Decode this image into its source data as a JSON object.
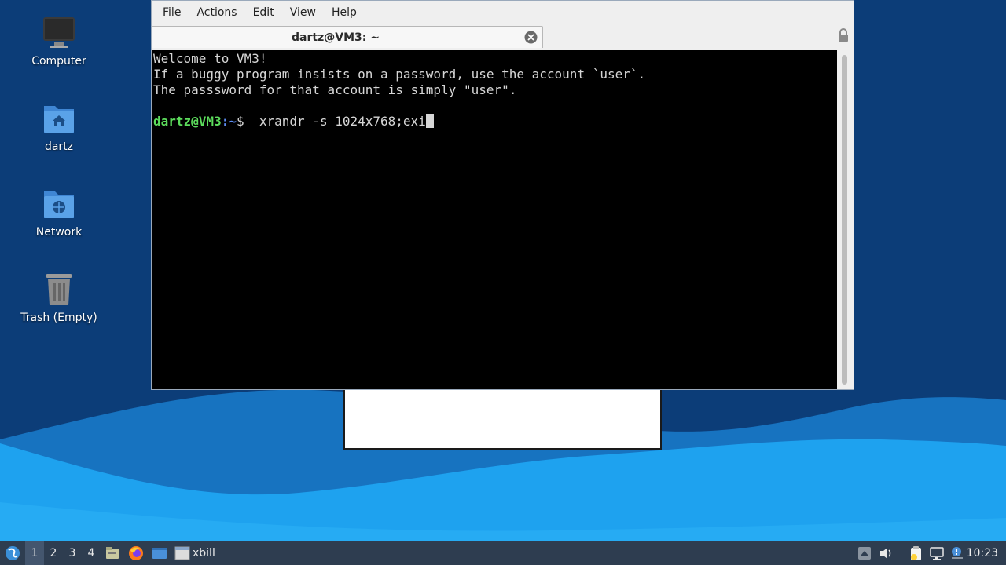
{
  "desktop": {
    "icons": [
      {
        "label": "Computer",
        "icon": "computer-icon"
      },
      {
        "label": "dartz",
        "icon": "home-folder-icon"
      },
      {
        "label": "Network",
        "icon": "network-folder-icon"
      },
      {
        "label": "Trash (Empty)",
        "icon": "trash-icon"
      }
    ]
  },
  "terminal": {
    "menu": [
      "File",
      "Actions",
      "Edit",
      "View",
      "Help"
    ],
    "tab_title": "dartz@VM3: ~",
    "lines": [
      "Welcome to VM3!",
      "If a buggy program insists on a password, use the account `user`.",
      "The passsword for that account is simply \"user\"."
    ],
    "prompt_user": "dartz@VM3",
    "prompt_path": ":~",
    "prompt_symbol": "$",
    "command": "  xrandr -s 1024x768;exi"
  },
  "taskbar": {
    "workspaces": [
      "1",
      "2",
      "3",
      "4"
    ],
    "active_workspace": "1",
    "window_button": "xbill",
    "clock": "10:23"
  },
  "colors": {
    "wallpaper_dark": "#0c3d78",
    "wave_light": "#1ea2ef",
    "taskbar": "#2e3d50",
    "prompt_user": "#5cdc5c",
    "prompt_path": "#5c8cf2"
  }
}
